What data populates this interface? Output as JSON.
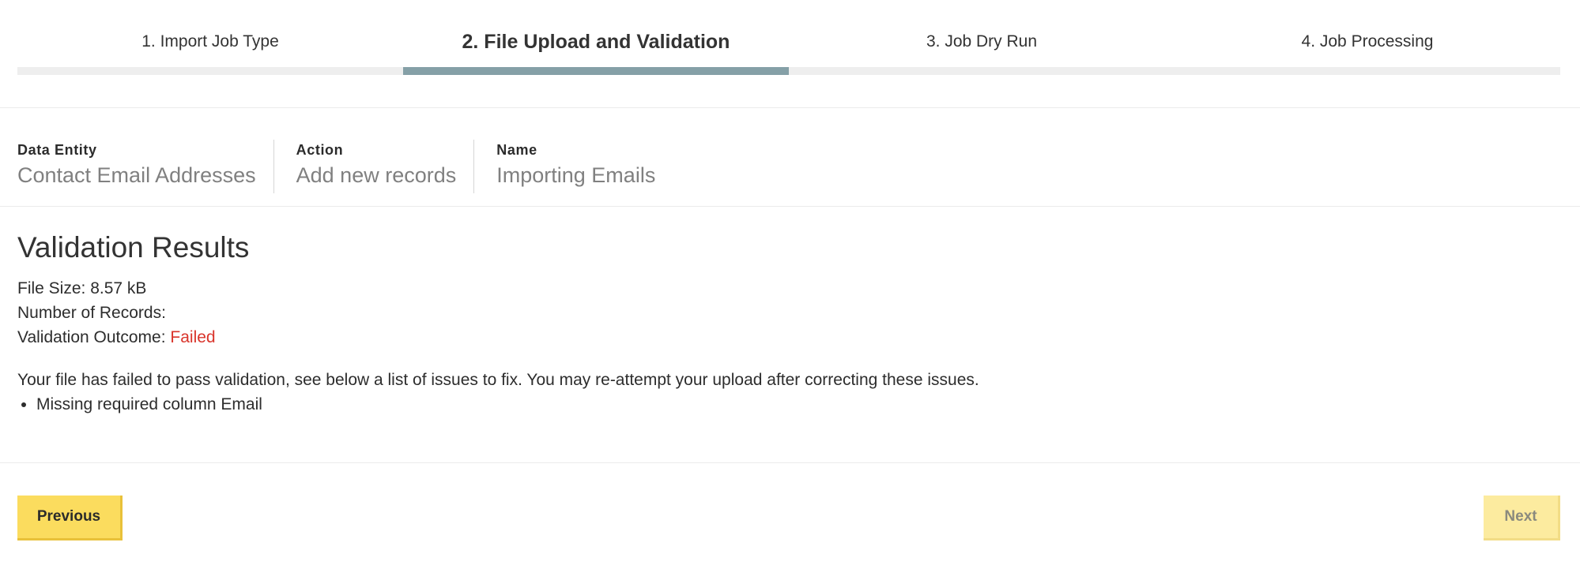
{
  "stepper": {
    "steps": [
      {
        "label": "1. Import Job Type",
        "active": false
      },
      {
        "label": "2. File Upload and Validation",
        "active": true
      },
      {
        "label": "3. Job Dry Run",
        "active": false
      },
      {
        "label": "4. Job Processing",
        "active": false
      }
    ],
    "colors": {
      "active_bar": "#85a0a7",
      "inactive_bar": "#eeeeee"
    }
  },
  "job_meta": {
    "data_entity": {
      "label": "Data Entity",
      "value": "Contact Email Addresses"
    },
    "action": {
      "label": "Action",
      "value": "Add new records"
    },
    "name": {
      "label": "Name",
      "value": "Importing Emails"
    }
  },
  "validation": {
    "title": "Validation Results",
    "file_size_label": "File Size:",
    "file_size_value": "8.57 kB",
    "records_label": "Number of Records:",
    "records_value": "",
    "outcome_label": "Validation Outcome:",
    "outcome_value": "Failed",
    "outcome_color": "#d9342b",
    "message": "Your file has failed to pass validation, see below a list of issues to fix. You may re-attempt your upload after correcting these issues.",
    "issues": [
      "Missing required column Email"
    ]
  },
  "footer": {
    "previous_label": "Previous",
    "next_label": "Next",
    "accent": "#fbdc5e"
  }
}
